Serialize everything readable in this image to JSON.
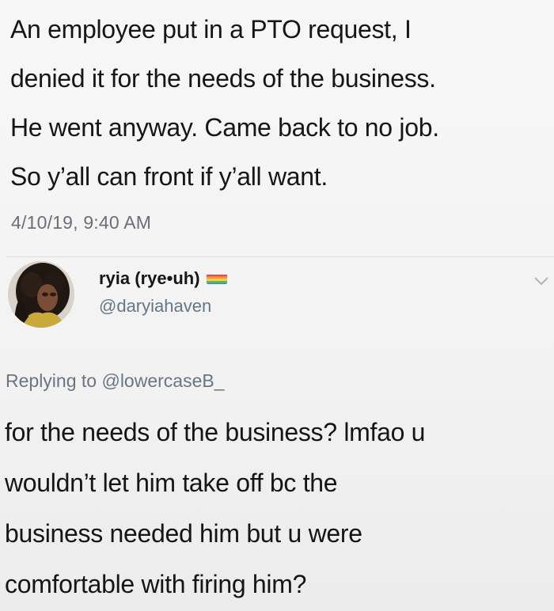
{
  "tweet": {
    "lines": [
      "An employee put in a PTO request, I",
      "denied it for the needs of the business.",
      "He went anyway. Came back to no job.",
      "So y’all can front if y’all want."
    ],
    "timestamp": "4/10/19, 9:40 AM"
  },
  "reply": {
    "display_name": "ryia (rye•uh)",
    "handle": "@daryiahaven",
    "flag_icon": "rainbow-flag-icon",
    "replying_prefix": "Replying to",
    "replying_mention": "@lowercaseB_",
    "lines": [
      "for the needs of the business? lmfao u",
      "wouldn’t let him take off bc the",
      "business needed him but u were",
      "comfortable with firing him?"
    ]
  },
  "colors": {
    "background": "#f5f5f5",
    "muted_text": "#657786",
    "divider": "#d9dcdf"
  }
}
